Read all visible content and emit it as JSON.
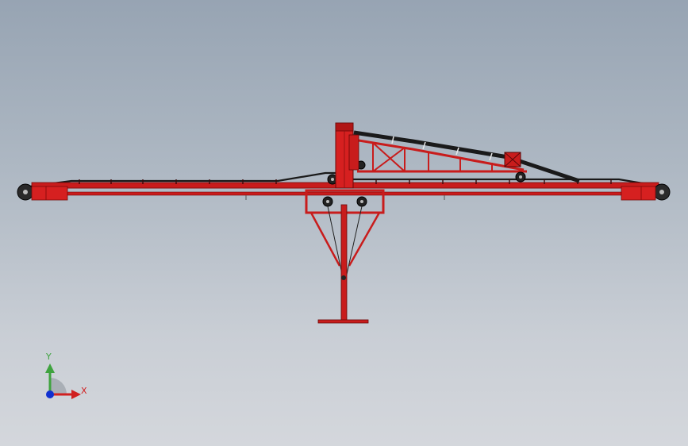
{
  "viewport": {
    "background_top": "#97a4b3",
    "background_bottom": "#d4d7dc"
  },
  "model": {
    "frame_color": "#c81c1c",
    "frame_dark": "#7a0a0a",
    "belt_color": "#1a1a1a"
  },
  "triad": {
    "x_label": "X",
    "y_label": "Y",
    "x_color": "#d02020",
    "y_color": "#3fa33f",
    "z_color": "#1030d0"
  }
}
